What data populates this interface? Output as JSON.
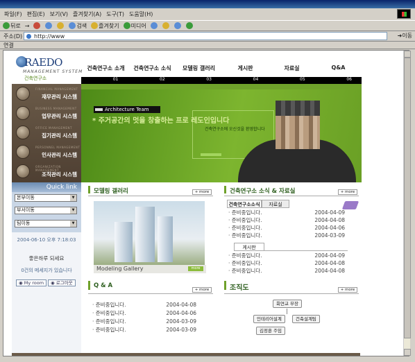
{
  "browser": {
    "menu": [
      "파일(F)",
      "편집(E)",
      "보기(V)",
      "즐겨찾기(A)",
      "도구(T)",
      "도움말(H)"
    ],
    "toolbar": {
      "back": "뒤로",
      "forward": "→",
      "search": "검색",
      "favorites": "즐겨찾기",
      "media": "미디어"
    },
    "address_label": "주소(D)",
    "address_value": "http://www",
    "go_label": "이동",
    "links_label": "연결"
  },
  "brand": {
    "name": "RAEDO",
    "sub": "MANAGEMENT SYSTEM",
    "kr": "건축연구소"
  },
  "nav": {
    "items": [
      "건축연구소 소개",
      "건축연구소 소식",
      "모델링 갤러리",
      "게시판",
      "자료실",
      "Q&A"
    ],
    "nums": [
      "01",
      "02",
      "03",
      "04",
      "05",
      "06"
    ]
  },
  "leftmenu": [
    {
      "en": "FINANCIAL MANAGEMENT",
      "kr": "재무관리 시스템"
    },
    {
      "en": "BUSINESS MANAGEMENT",
      "kr": "업무관리 시스템"
    },
    {
      "en": "OFFICE MANAGEMENT",
      "kr": "집기관리 시스템"
    },
    {
      "en": "PERSONNEL MANAGEMENT",
      "kr": "인사관리 시스템"
    },
    {
      "en": "ORGANIZATION MANAGEMENT",
      "kr": "조직관리 시스템"
    }
  ],
  "hero": {
    "tag": "Architecture Team",
    "slogan": "* 주거공간의 멋을 창출하는 프로 레도인입니다",
    "sub": "건축연구소에 오신것을 환영합니다"
  },
  "quicklink": {
    "title": "Quick link",
    "selects": [
      "본부이동",
      "부서이동",
      "팀이동"
    ],
    "datetime": "2004-06-10 오후 7:18:03",
    "greeting": "좋은하루 되세요",
    "messages": "0건의 메세지가 있습니다",
    "myroom": "My room",
    "logout": "로그아웃"
  },
  "gallery": {
    "title": "모델링 갤러리",
    "caption": "Modeling Gallery",
    "more": "+ more",
    "more2": "more"
  },
  "news": {
    "title": "건축연구소 소식 & 자료실",
    "more": "+ more",
    "tab1": "건축연구소소식",
    "tab2": "자료실",
    "tab3": "게시판",
    "rows1": [
      {
        "t": "준비중입니다.",
        "d": "2004-04-09"
      },
      {
        "t": "준비중입니다.",
        "d": "2004-04-08"
      },
      {
        "t": "준비중입니다.",
        "d": "2004-04-06"
      },
      {
        "t": "준비중입니다.",
        "d": "2004-03-09"
      }
    ],
    "rows2": [
      {
        "t": "준비중입니다.",
        "d": "2004-04-09"
      },
      {
        "t": "준비중입니다.",
        "d": "2004-04-08"
      },
      {
        "t": "준비중입니다.",
        "d": "2004-04-08"
      }
    ]
  },
  "qna": {
    "title": "Q & A",
    "more": "+ more",
    "rows": [
      {
        "t": "준비중입니다.",
        "d": "2004-04-08"
      },
      {
        "t": "준비중입니다.",
        "d": "2004-04-06"
      },
      {
        "t": "준비중입니다.",
        "d": "2004-03-09"
      },
      {
        "t": "준비중입니다.",
        "d": "2004-03-09"
      }
    ]
  },
  "org": {
    "title": "조직도",
    "more": "+ more",
    "ceo": "회연교 부장",
    "b1": "인테리어설계",
    "b2": "건축설계팀",
    "b3": "김정훈 주임"
  }
}
